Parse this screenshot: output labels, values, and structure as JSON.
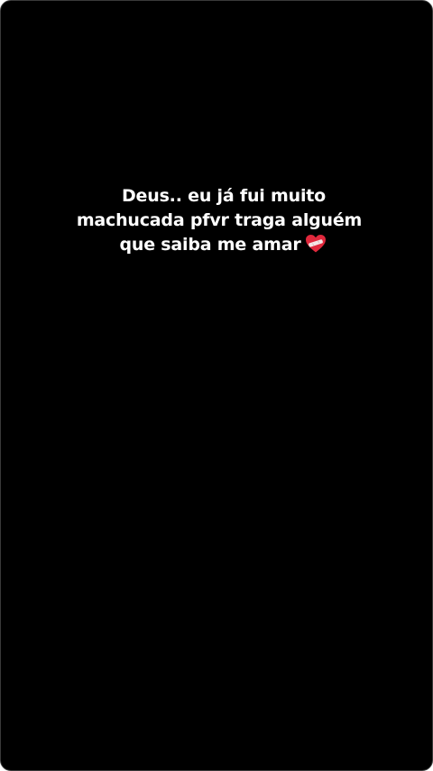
{
  "story": {
    "lines": [
      "Deus.. eu já fui muito",
      "machucada pfvr traga alguém",
      "que saiba me amar"
    ],
    "emoji": "mending-heart-icon"
  },
  "colors": {
    "background": "#000000",
    "text": "#ffffff",
    "heart": "#e0283c"
  }
}
